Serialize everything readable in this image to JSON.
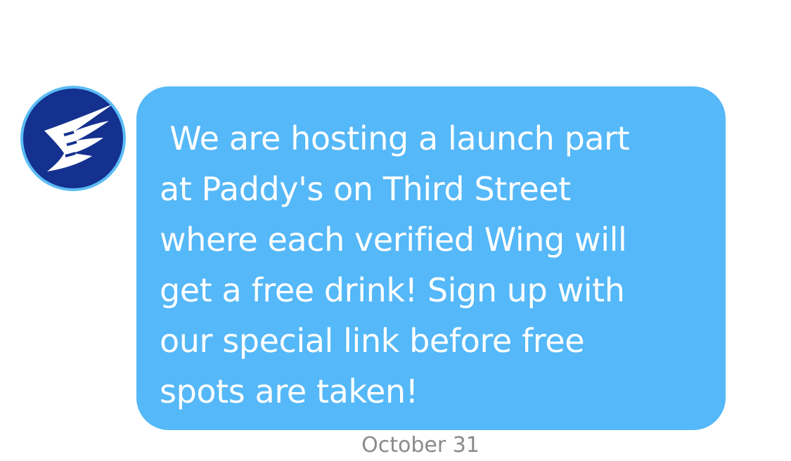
{
  "message": {
    "sender_icon": "wing-logo-icon",
    "text": " We are hosting a launch part\nat Paddy's on Third Street\nwhere each verified Wing will\nget a free drink! Sign up with\nour special link before free\nspots are taken!",
    "timestamp": "October 31"
  },
  "colors": {
    "bubble": "#55b8f8",
    "bubble_text": "#ffffff",
    "avatar_bg": "#14318f",
    "avatar_ring": "#5bbcf5",
    "timestamp": "#8a8a8e"
  }
}
